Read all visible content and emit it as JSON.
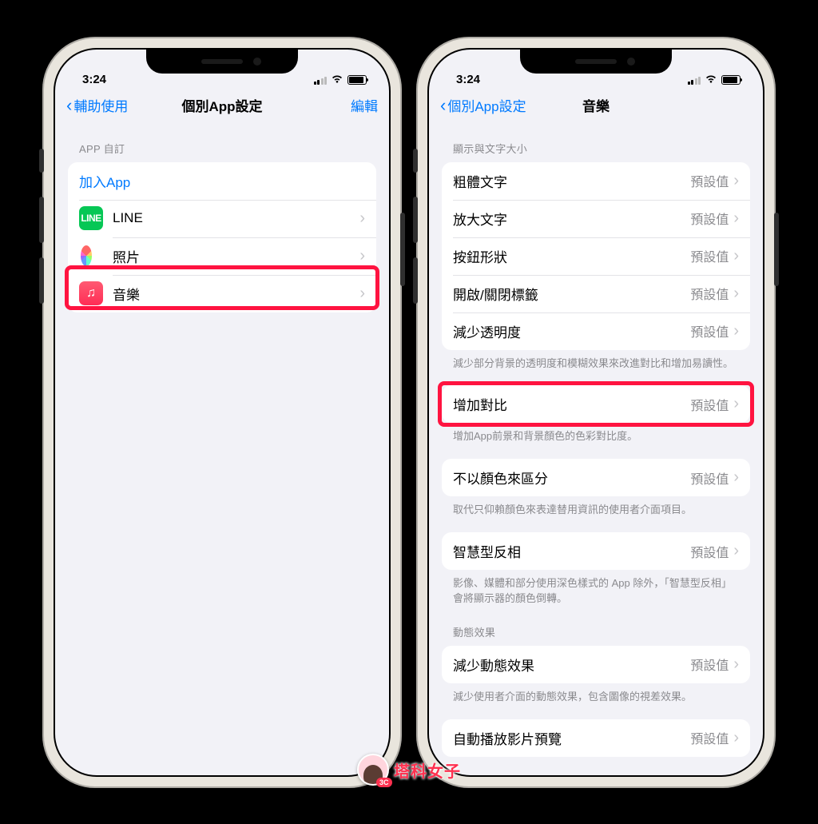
{
  "status": {
    "time": "3:24"
  },
  "watermark": {
    "badge": "3C",
    "text": "塔科女子"
  },
  "left": {
    "nav": {
      "back": "輔助使用",
      "title": "個別App設定",
      "action": "編輯"
    },
    "section_header": "APP 自訂",
    "add_app": "加入App",
    "apps": [
      {
        "name": "LINE",
        "icon": "line"
      },
      {
        "name": "照片",
        "icon": "photos"
      },
      {
        "name": "音樂",
        "icon": "music"
      }
    ]
  },
  "right": {
    "nav": {
      "back": "個別App設定",
      "title": "音樂"
    },
    "default_value": "預設值",
    "sections": [
      {
        "header": "顯示與文字大小",
        "rows": [
          "粗體文字",
          "放大文字",
          "按鈕形狀",
          "開啟/關閉標籤",
          "減少透明度"
        ],
        "footer": "減少部分背景的透明度和模糊效果來改進對比和增加易讀性。"
      },
      {
        "rows": [
          "增加對比"
        ],
        "footer": "增加App前景和背景顏色的色彩對比度。"
      },
      {
        "rows": [
          "不以顏色來區分"
        ],
        "footer": "取代只仰賴顏色來表達替用資訊的使用者介面項目。"
      },
      {
        "rows": [
          "智慧型反相"
        ],
        "footer": "影像、媒體和部分使用深色樣式的 App 除外，「智慧型反相」會將顯示器的顏色倒轉。"
      },
      {
        "header": "動態效果",
        "rows": [
          "減少動態效果"
        ],
        "footer": "減少使用者介面的動態效果，包含圖像的視差效果。"
      },
      {
        "rows": [
          "自動播放影片預覽"
        ]
      }
    ]
  }
}
